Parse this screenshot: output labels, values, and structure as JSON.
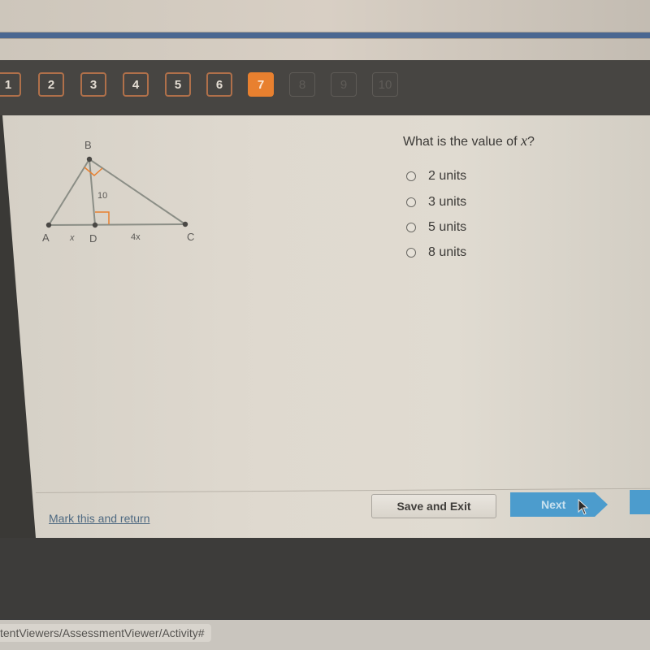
{
  "navigation": {
    "questions": [
      {
        "label": "1",
        "state": "answered"
      },
      {
        "label": "2",
        "state": "answered"
      },
      {
        "label": "3",
        "state": "answered"
      },
      {
        "label": "4",
        "state": "answered"
      },
      {
        "label": "5",
        "state": "answered"
      },
      {
        "label": "6",
        "state": "answered"
      },
      {
        "label": "7",
        "state": "current"
      },
      {
        "label": "8",
        "state": "locked"
      },
      {
        "label": "9",
        "state": "locked"
      },
      {
        "label": "10",
        "state": "locked"
      }
    ]
  },
  "diagram": {
    "vertex_labels": {
      "A": "A",
      "B": "B",
      "C": "C",
      "D": "D"
    },
    "segment_labels": {
      "BD": "10",
      "AD": "x",
      "DC": "4x"
    },
    "right_angle_marks": [
      "ABC",
      "BDC"
    ],
    "accent_color": "#e8802f"
  },
  "question": {
    "prompt_prefix": "What is the value of ",
    "variable": "x",
    "prompt_suffix": "?",
    "options": [
      {
        "label": "2 units",
        "selected": false
      },
      {
        "label": "3 units",
        "selected": false
      },
      {
        "label": "5 units",
        "selected": false
      },
      {
        "label": "8 units",
        "selected": false
      }
    ]
  },
  "footer": {
    "mark_link": "Mark this and return",
    "save_exit": "Save and Exit",
    "next": "Next"
  },
  "status_bar": {
    "url": "tentViewers/AssessmentViewer/Activity#"
  },
  "colors": {
    "current_question": "#e8802f",
    "answered_border": "#b0704a",
    "primary_button": "#4c9ccd",
    "header_rule": "#4a6791"
  }
}
